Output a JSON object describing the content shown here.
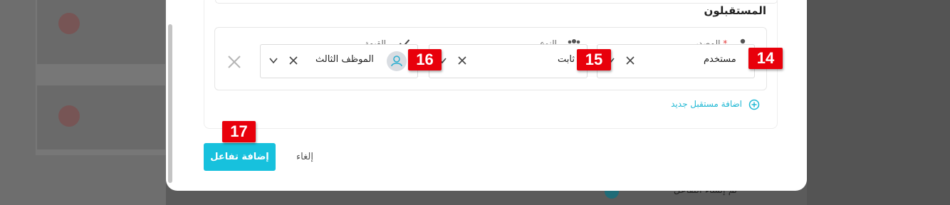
{
  "section": {
    "title": "المستقبلون"
  },
  "receiver_row": {
    "source": {
      "label": "المصدر",
      "required_mark": "*",
      "value": "مستخدم",
      "icon": "user-icon"
    },
    "type": {
      "label": "النوع",
      "value": "ثابت",
      "icon": "group-icon"
    },
    "value": {
      "label": "القيمة",
      "value": "الموظف الثالث",
      "icon": "check-icon",
      "avatar_icon": "user-avatar-icon"
    }
  },
  "add_receiver": {
    "label": "اضافة مستقبل جديد",
    "icon": "plus-circle-icon"
  },
  "actions": {
    "submit_label": "إضافة تفاعل",
    "cancel_label": "إلغاء"
  },
  "badges": [
    "14",
    "15",
    "16",
    "17"
  ],
  "background": {
    "status_text": "تم إنشاء التفاعل"
  },
  "colors": {
    "accent": "#17c1dd",
    "badge": "#e8000b",
    "required": "#e23636"
  }
}
